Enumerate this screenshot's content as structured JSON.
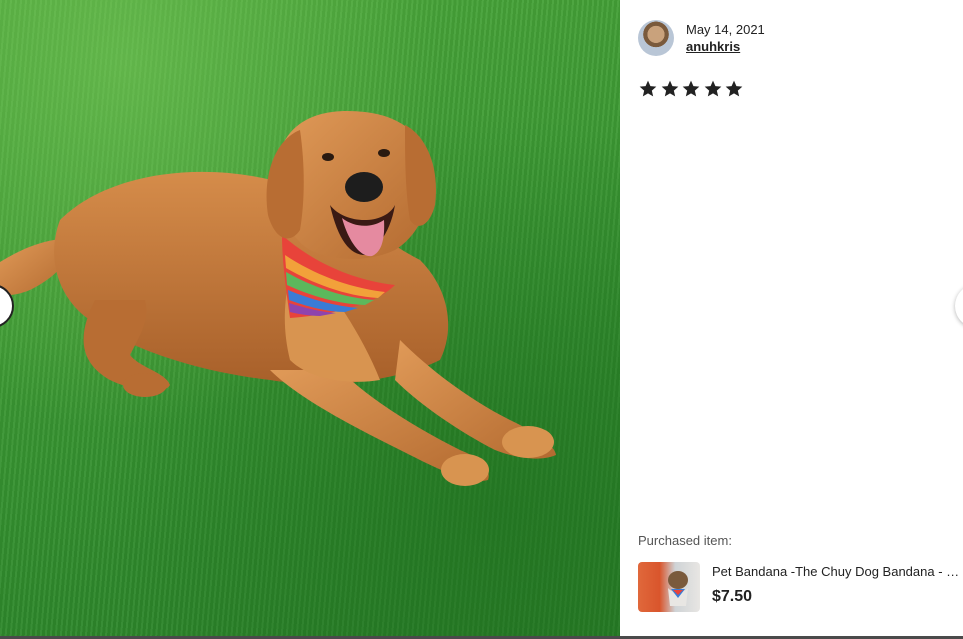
{
  "review": {
    "date": "May 14, 2021",
    "reviewer_name": "anuhkris",
    "rating": 5,
    "rating_max": 5
  },
  "purchased": {
    "label": "Purchased item:",
    "title": "Pet Bandana -The Chuy Dog Bandana - Mexican Blanket",
    "price": "$7.50"
  },
  "icons": {
    "star": "star-icon",
    "prev": "chevron-left-icon",
    "next": "chevron-right-icon"
  },
  "colors": {
    "grass": "#3d9a34",
    "dog": "#c47a3c",
    "bandana_stripes": [
      "#e8433a",
      "#f2a13a",
      "#f5d942",
      "#5cb85c",
      "#3a7bd5",
      "#8e44ad",
      "#e84393"
    ]
  }
}
